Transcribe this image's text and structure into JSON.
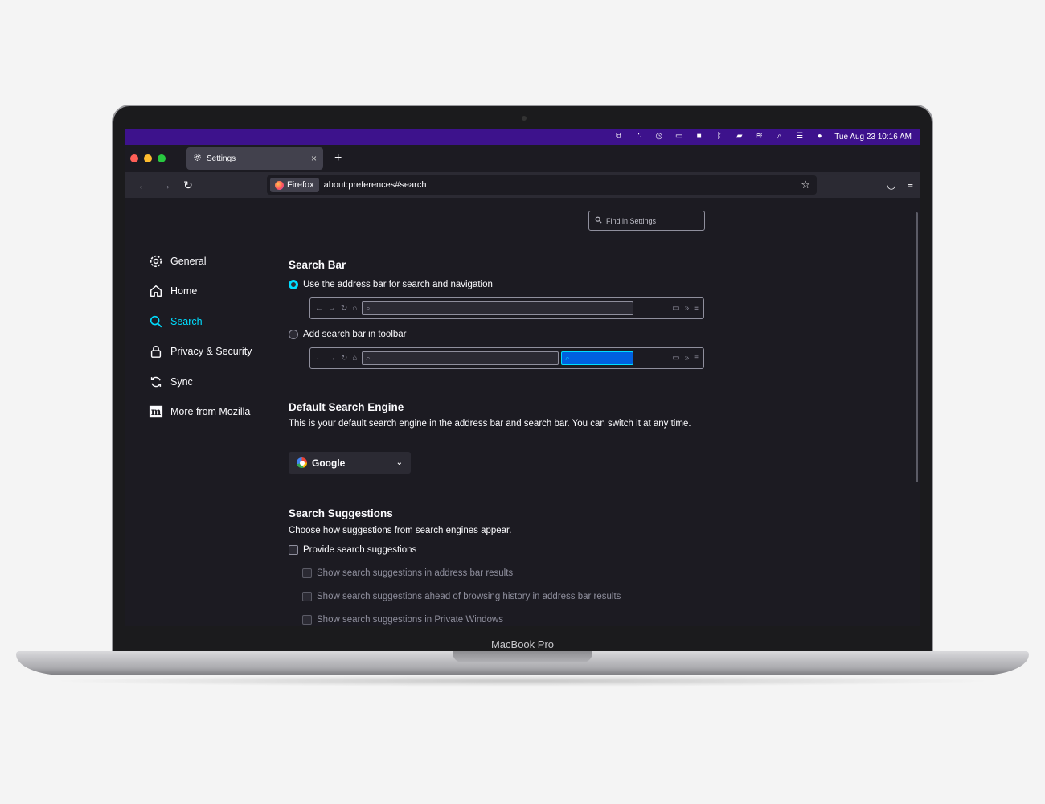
{
  "device": {
    "brand_label": "MacBook Pro"
  },
  "menubar": {
    "clock": "Tue Aug 23  10:16 AM"
  },
  "tab": {
    "label": "Settings",
    "close": "×",
    "new_tab": "+"
  },
  "navbar": {
    "identity_label": "Firefox",
    "url": "about:preferences#search"
  },
  "find": {
    "placeholder": "Find in Settings"
  },
  "sidebar": {
    "items": [
      {
        "label": "General"
      },
      {
        "label": "Home"
      },
      {
        "label": "Search"
      },
      {
        "label": "Privacy & Security"
      },
      {
        "label": "Sync"
      },
      {
        "label": "More from Mozilla"
      }
    ],
    "active": "Search"
  },
  "search_bar": {
    "heading": "Search Bar",
    "option_address": "Use the address bar for search and navigation",
    "option_toolbar": "Add search bar in toolbar",
    "selected": "option_address"
  },
  "default_engine": {
    "heading": "Default Search Engine",
    "description": "This is your default search engine in the address bar and search bar. You can switch it at any time.",
    "selected": "Google"
  },
  "suggestions": {
    "heading": "Search Suggestions",
    "description": "Choose how suggestions from search engines appear.",
    "provide": "Provide search suggestions",
    "sub_options": [
      "Show search suggestions in address bar results",
      "Show search suggestions ahead of browsing history in address bar results",
      "Show search suggestions in Private Windows"
    ]
  },
  "colors": {
    "accent": "#00ddff",
    "menubar": "#3d128c",
    "background": "#1c1b22"
  }
}
